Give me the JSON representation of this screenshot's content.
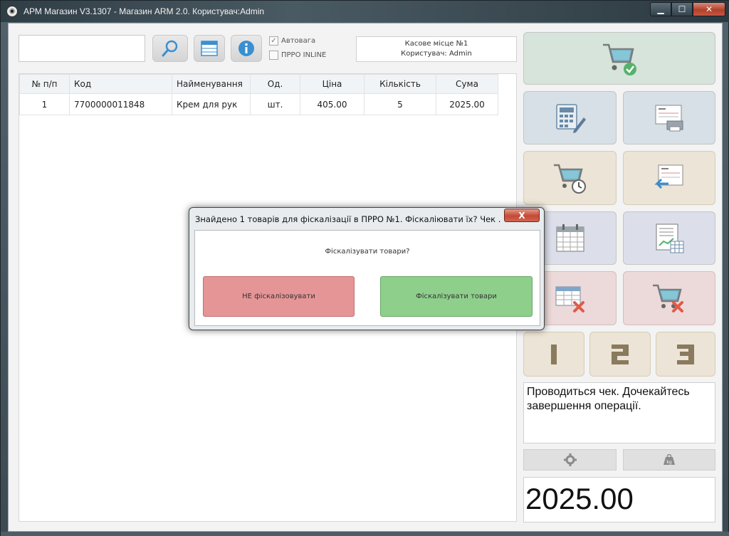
{
  "window": {
    "title": "АРМ Магазин V3.1307 - Магазин ARM 2.0. Користувач:Admin"
  },
  "toolbar": {
    "search_value": "",
    "icons": [
      "search-icon",
      "table-icon",
      "info-icon"
    ],
    "autoweight_label": "Автовага",
    "autoweight_checked": true,
    "prro_inline_label": "ПРРО INLINE",
    "prro_inline_checked": false
  },
  "register_info": {
    "line1": "Касове місце №1",
    "line2": "Користувач: Admin"
  },
  "table": {
    "columns": [
      "№ п/п",
      "Код",
      "Найменування",
      "Од.",
      "Ціна",
      "Кількість",
      "Сума"
    ],
    "rows": [
      [
        "1",
        "7700000011848",
        "Крем для рук",
        "шт.",
        "405.00",
        "5",
        "2025.00"
      ]
    ]
  },
  "dialog": {
    "title": "Знайдено 1 товарів для фіскалізації в ПРРО №1. Фіскаліювати їх? Чек ...",
    "question": "Фіскалізувати товари?",
    "no_label": "НЕ фіскалізовувати",
    "yes_label": "Фіскалізувати товари",
    "close_symbol": "X"
  },
  "right_panel": {
    "numbers": [
      "1",
      "2",
      "3"
    ],
    "status_text": "Проводиться чек. Дочекайтесь завершення операції.",
    "settings_icon": "gear-icon",
    "scale_icon": "weight-icon",
    "scale_label": "kg",
    "total": "2025.00"
  },
  "colors": {
    "dialog_no": "#e69597",
    "dialog_yes": "#8fcf8c",
    "green_button": "#d6e4dc",
    "beige_button": "#ece4d6",
    "pink_button": "#ecd9d9"
  }
}
